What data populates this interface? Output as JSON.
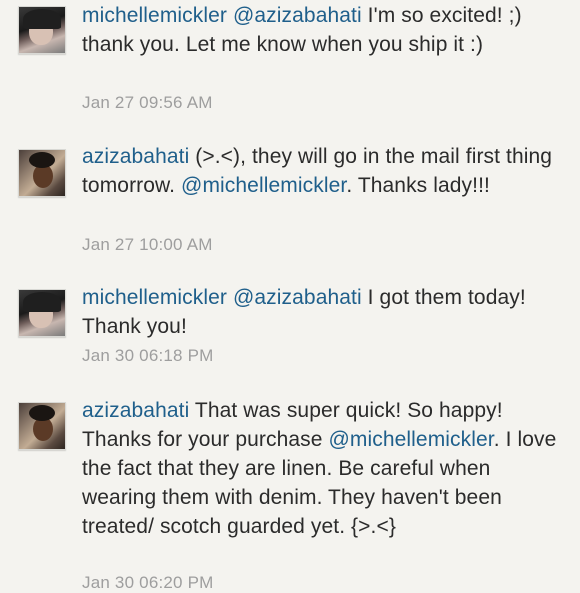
{
  "comments": [
    {
      "username": "michellemickler",
      "mention_before": "@azizabahati",
      "text_before": " I'm so excited! ;) thank you. Let me know when you ship it :)",
      "mention_after": "",
      "text_after": "",
      "timestamp": "Jan 27 09:56 AM",
      "avatar_icon": "user-avatar-icon"
    },
    {
      "username": "azizabahati",
      "mention_before": "",
      "text_before": "  (>.<), they will go in the mail first thing tomorrow. ",
      "mention_after": "@michellemickler",
      "text_after": ". Thanks lady!!!",
      "timestamp": "Jan 27 10:00 AM",
      "avatar_icon": "user-avatar-icon"
    },
    {
      "username": "michellemickler",
      "mention_before": "@azizabahati",
      "text_before": " I got them today! Thank you!",
      "mention_after": "",
      "text_after": "",
      "timestamp": "Jan 30 06:18 PM",
      "avatar_icon": "user-avatar-icon"
    },
    {
      "username": "azizabahati",
      "mention_before": "",
      "text_before": "  That was super quick! So happy! Thanks for your purchase ",
      "mention_after": "@michellemickler",
      "text_after": ". I love the fact that they are linen. Be careful when wearing them with denim. They haven't been treated/ scotch guarded yet. {>.<}",
      "timestamp": "Jan 30 06:20 PM",
      "avatar_icon": "user-avatar-icon"
    }
  ],
  "colors": {
    "background": "#f4f3ef",
    "username": "#1f5f8b",
    "text": "#2b2b2b",
    "timestamp": "#9e9e9e"
  }
}
